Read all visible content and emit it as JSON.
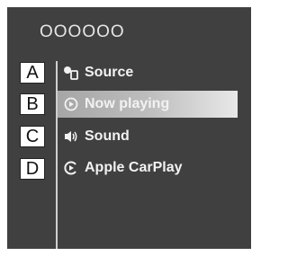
{
  "header": {
    "title": "OOOOOO"
  },
  "menu": {
    "items": [
      {
        "letter": "A",
        "label": "Source",
        "icon": "source-icon"
      },
      {
        "letter": "B",
        "label": "Now playing",
        "icon": "play-icon",
        "active": true
      },
      {
        "letter": "C",
        "label": "Sound",
        "icon": "speaker-icon"
      },
      {
        "letter": "D",
        "label": "Apple CarPlay",
        "icon": "carplay-icon"
      }
    ]
  },
  "colors": {
    "background": "#404040",
    "highlight": "#bdbdbd",
    "text": "#f2f2f2"
  }
}
